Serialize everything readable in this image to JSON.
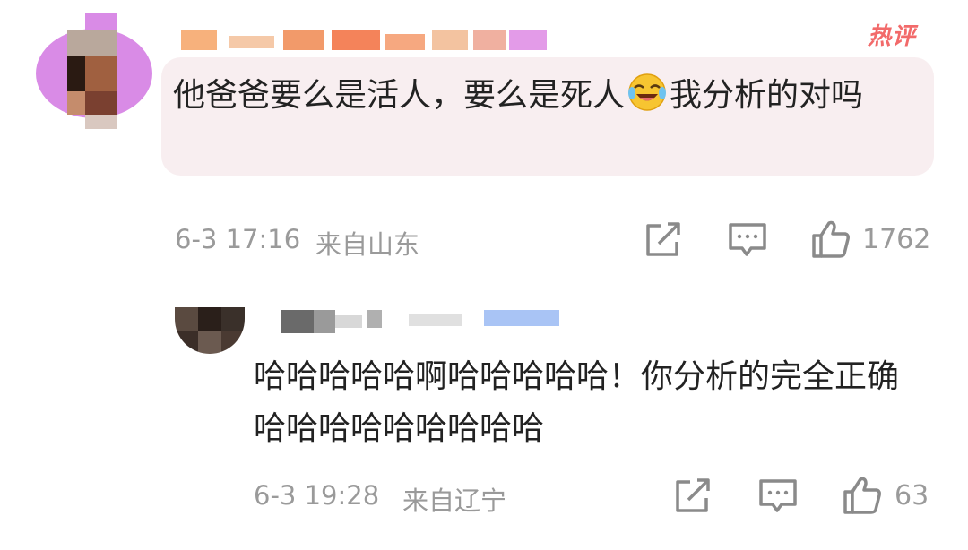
{
  "hot_tag": "热评",
  "comment": {
    "text_before_emoji": "他爸爸要么是活人，要么是死人",
    "emoji": "laughing-tears-emoji",
    "text_after_emoji": "我分析的对吗",
    "timestamp": "6-3 17:16",
    "location": "来自山东",
    "likes": "1762"
  },
  "reply": {
    "text": "哈哈哈哈哈啊哈哈哈哈哈！你分析的完全正确哈哈哈哈哈哈哈哈哈",
    "timestamp": "6-3 19:28",
    "location": "来自辽宁",
    "likes": "63"
  },
  "icons": {
    "share": "share-icon",
    "reply": "comment-icon",
    "like": "thumbs-up-icon"
  },
  "colors": {
    "hot_tag": "#f26a6a",
    "bubble_bg": "#f8eef0",
    "meta_text": "#9a9a9a",
    "body_text": "#222222"
  }
}
